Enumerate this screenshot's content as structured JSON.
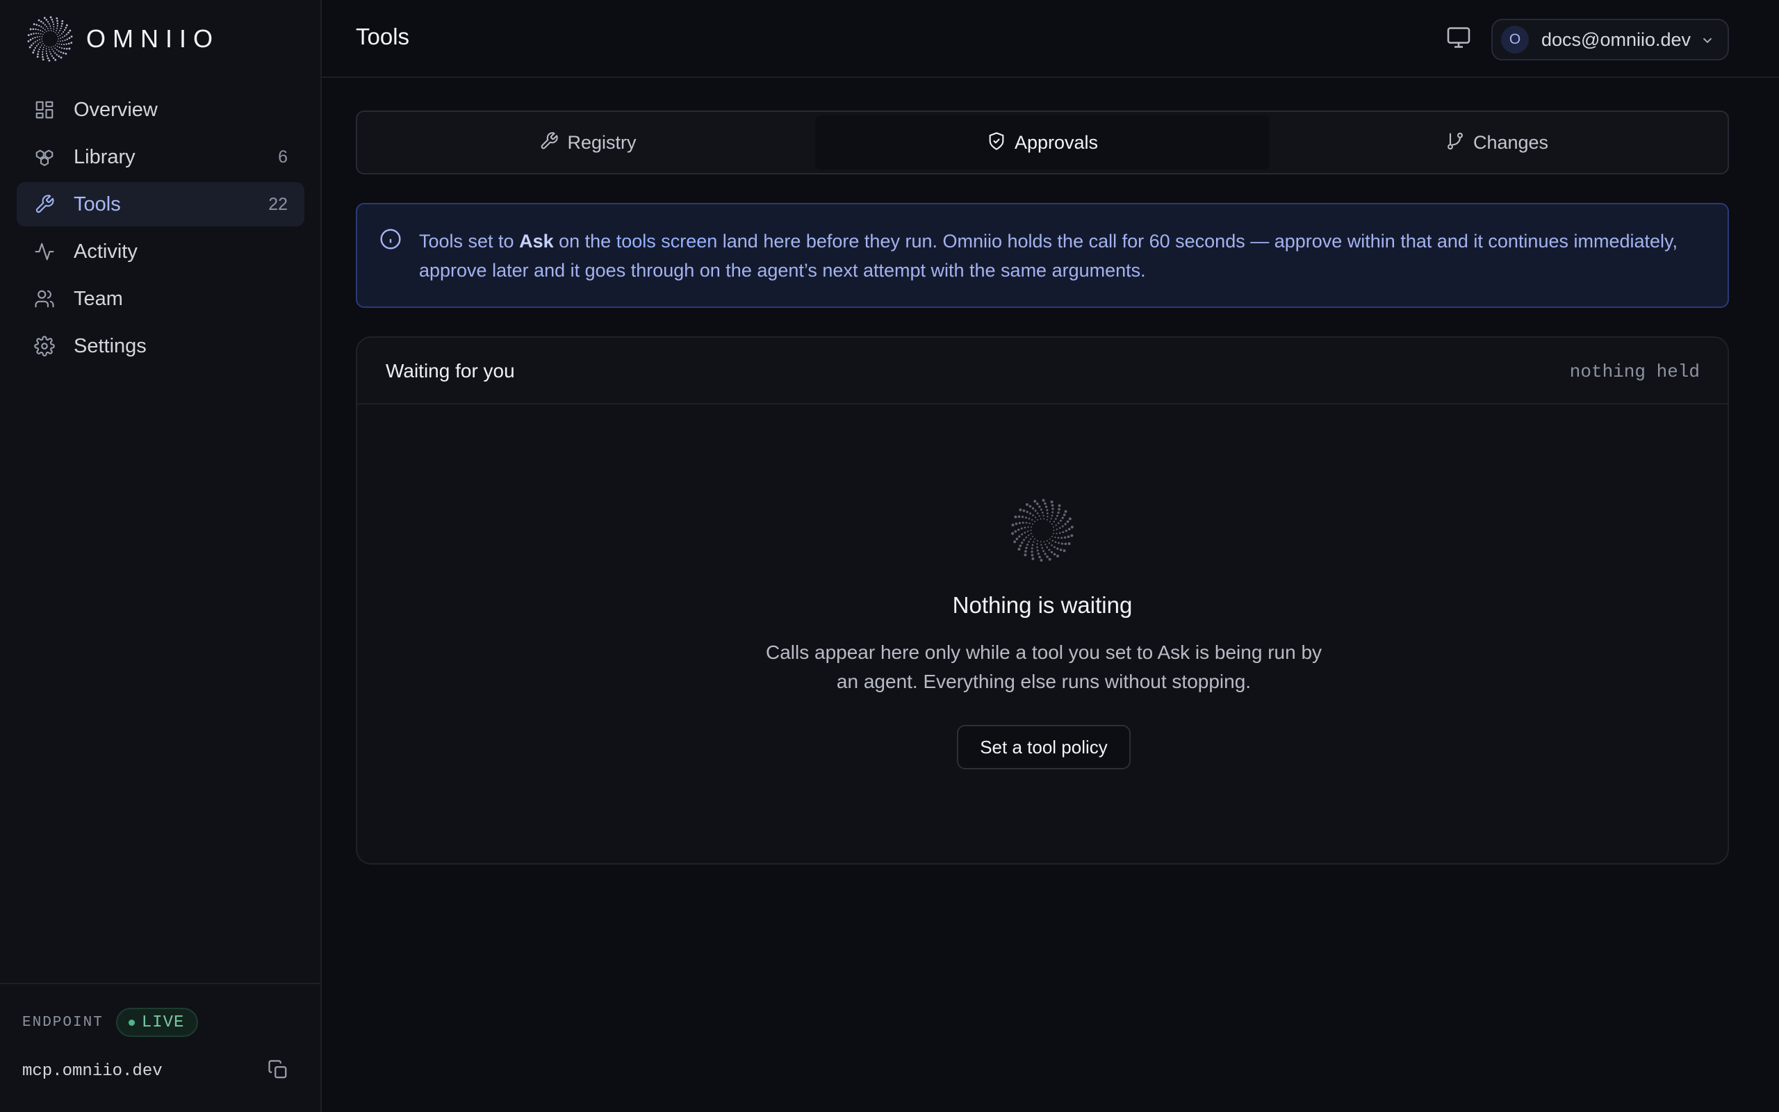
{
  "brand": {
    "name": "OMNIIO"
  },
  "sidebar": {
    "items": [
      {
        "label": "Overview",
        "count": "",
        "icon": "grid-icon",
        "active": false
      },
      {
        "label": "Library",
        "count": "6",
        "icon": "boxes-icon",
        "active": false
      },
      {
        "label": "Tools",
        "count": "22",
        "icon": "wrench-icon",
        "active": true
      },
      {
        "label": "Activity",
        "count": "",
        "icon": "pulse-icon",
        "active": false
      },
      {
        "label": "Team",
        "count": "",
        "icon": "users-icon",
        "active": false
      },
      {
        "label": "Settings",
        "count": "",
        "icon": "gear-icon",
        "active": false
      }
    ],
    "footer": {
      "endpoint_label": "ENDPOINT",
      "live_label": "LIVE",
      "host": "mcp.omniio.dev"
    }
  },
  "header": {
    "title": "Tools",
    "account_initial": "O",
    "account_email": "docs@omniio.dev"
  },
  "tabs": [
    {
      "label": "Registry",
      "icon": "wrench-icon",
      "active": false
    },
    {
      "label": "Approvals",
      "icon": "shield-check-icon",
      "active": true
    },
    {
      "label": "Changes",
      "icon": "git-branch-icon",
      "active": false
    }
  ],
  "info": {
    "part1": "Tools set to ",
    "bold": "Ask",
    "part2": " on the ",
    "link": "tools screen",
    "part3": " land here before they run. Omniio holds the call for 60 seconds — approve within that and it continues immediately, approve later and it goes through on the agent’s next attempt with the same arguments."
  },
  "panel": {
    "title": "Waiting for you",
    "status": "nothing held",
    "empty_title": "Nothing is waiting",
    "empty_desc": "Calls appear here only while a tool you set to Ask is being run by an agent. Everything else runs without stopping.",
    "button_label": "Set a tool policy"
  },
  "colors": {
    "accent": "#a9b8f5",
    "live": "#79c8a4",
    "background": "#0b0d12"
  }
}
